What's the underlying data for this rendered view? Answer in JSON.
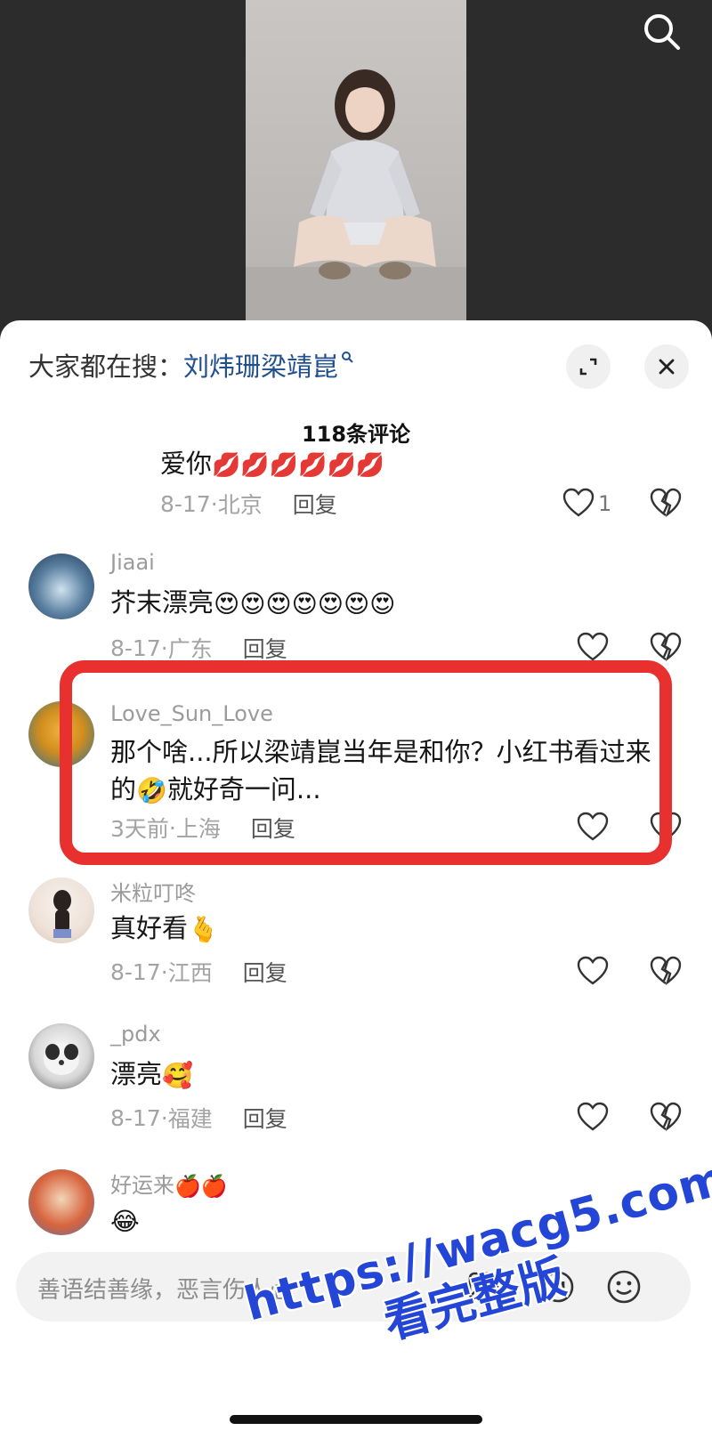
{
  "hot_search": {
    "prefix": "大家都在搜：",
    "query": "刘炜珊梁靖崑"
  },
  "comment_count": "118条评论",
  "comments": [
    {
      "username": "",
      "text": "爱你",
      "emoji": "💋💋💋💋💋💋",
      "date": "8-17",
      "location": "北京",
      "reply_label": "回复",
      "likes": "1"
    },
    {
      "username": "Jiaai",
      "text": "芥末漂亮",
      "emoji": "😍😍😍😍😍😍😍",
      "date": "8-17",
      "location": "广东",
      "reply_label": "回复",
      "likes": ""
    },
    {
      "username": "Love_Sun_Love",
      "text_line1": "那个啥...所以梁靖崑当年是和你？小红书看过来",
      "text_line2_a": "的",
      "text_line2_emoji": "🤣",
      "text_line2_b": "就好奇一问...",
      "date": "3天前",
      "location": "上海",
      "reply_label": "回复",
      "likes": ""
    },
    {
      "username": "米粒叮咚",
      "text": "真好看",
      "emoji": "🫰",
      "date": "8-17",
      "location": "江西",
      "reply_label": "回复",
      "likes": ""
    },
    {
      "username": "_pdx",
      "text": "漂亮",
      "emoji": "🥰",
      "date": "8-17",
      "location": "福建",
      "reply_label": "回复",
      "likes": ""
    },
    {
      "username": "好运来",
      "username_emoji": "🍎🍎",
      "text": "",
      "emoji": "😂"
    }
  ],
  "input": {
    "placeholder": "善语结善缘，恶言伤人心"
  },
  "watermark": {
    "url": "https://wacg5.com",
    "sub": "看完整版"
  },
  "colors": {
    "accent_link": "#1f4f8f",
    "highlight": "#e8302f",
    "watermark": "#2346d6"
  }
}
